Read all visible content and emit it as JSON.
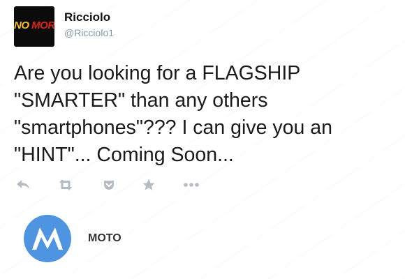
{
  "user": {
    "display_name": "Ricciolo",
    "handle": "@Ricciolo1",
    "avatar": {
      "text_part1": "NO",
      "text_part2": "MORE",
      "background": "#0b0b0b",
      "color_part1": "#f7c21a",
      "color_part2": "#e2231a"
    }
  },
  "tweet": {
    "lines": [
      "Are you looking for a FLAGSHIP",
      "\"SMARTER\" than any others",
      "\"smartphones\"??? I can give you an",
      "\"HINT\"... Coming Soon..."
    ]
  },
  "actions": [
    {
      "name": "reply",
      "icon": "reply-icon"
    },
    {
      "name": "retweet",
      "icon": "retweet-icon"
    },
    {
      "name": "save",
      "icon": "pocket-icon"
    },
    {
      "name": "favorite",
      "icon": "star-icon"
    },
    {
      "name": "more",
      "icon": "more-icon"
    }
  ],
  "card": {
    "brand_label": "MOTO",
    "logo_icon": "motorola-logo",
    "logo_color": "#4f94e0"
  },
  "colors": {
    "text": "#1a1a1a",
    "muted": "#8899a6",
    "action_icon": "#b6bcc3"
  }
}
